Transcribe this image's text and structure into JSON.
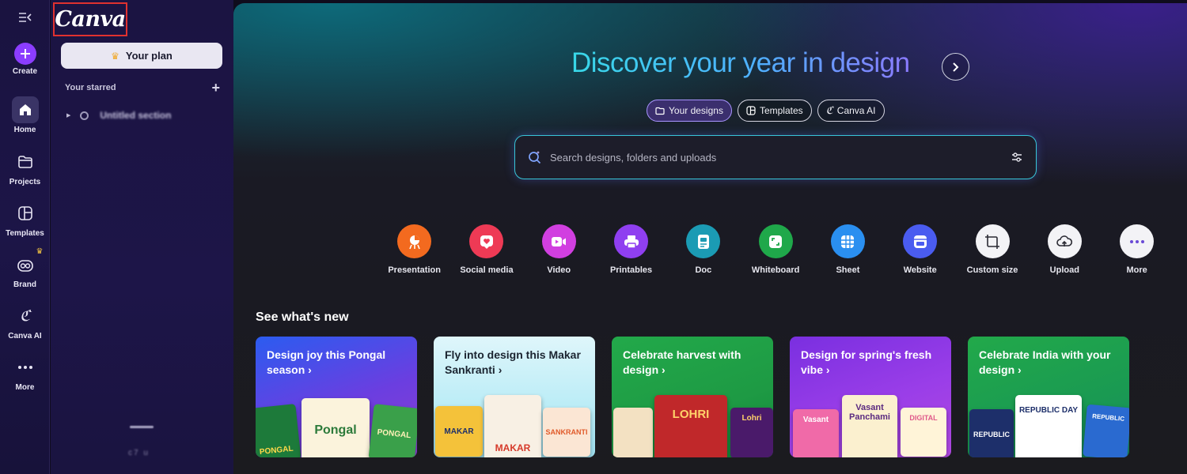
{
  "rail": {
    "items": [
      {
        "label": "Create",
        "icon": "plus-icon"
      },
      {
        "label": "Home",
        "icon": "home-icon",
        "active": true
      },
      {
        "label": "Projects",
        "icon": "folder-icon"
      },
      {
        "label": "Templates",
        "icon": "templates-icon"
      },
      {
        "label": "Brand",
        "icon": "brand-icon"
      },
      {
        "label": "Canva AI",
        "icon": "canva-ai-icon"
      },
      {
        "label": "More",
        "icon": "more-dots-icon"
      }
    ]
  },
  "panel": {
    "logo": "Canva",
    "plan_button": "Your plan",
    "starred_label": "Your starred",
    "section_name": "Untitled section",
    "bottom_text": "c7 u"
  },
  "hero": {
    "title": "Discover your year in design",
    "chips": [
      "Your designs",
      "Templates",
      "Canva AI"
    ],
    "search_placeholder": "Search designs, folders and uploads"
  },
  "tools": [
    {
      "label": "Presentation",
      "color": "#f36a1f"
    },
    {
      "label": "Social media",
      "color": "#ee3a55"
    },
    {
      "label": "Video",
      "color": "#d13fe0"
    },
    {
      "label": "Printables",
      "color": "#8f3ff0"
    },
    {
      "label": "Doc",
      "color": "#1b9bb4"
    },
    {
      "label": "Whiteboard",
      "color": "#1fa84a"
    },
    {
      "label": "Sheet",
      "color": "#2a8ff0"
    },
    {
      "label": "Website",
      "color": "#4a5cf0"
    },
    {
      "label": "Custom size",
      "color": "#f3f3f6"
    },
    {
      "label": "Upload",
      "color": "#f3f3f6"
    },
    {
      "label": "More",
      "color": "#f3f3f6"
    }
  ],
  "whats_new": {
    "title": "See what's new",
    "cards": [
      {
        "title": "Design joy this Pongal season",
        "t1": "PONGAL",
        "t2": "Pongal",
        "t3": "PONGAL"
      },
      {
        "title": "Fly into design this Makar Sankranti",
        "t1": "MAKAR",
        "t2": "MAKAR",
        "t3": "SANKRANTI"
      },
      {
        "title": "Celebrate harvest with design",
        "t1": "",
        "t2": "LOHRI",
        "t3": "Lohri"
      },
      {
        "title": "Design for spring's fresh vibe",
        "t1": "Vasant",
        "t2": "Vasant Panchami",
        "t3": "DIGITAL"
      },
      {
        "title": "Celebrate India with your design",
        "t1": "REPUBLIC",
        "t2": "REPUBLIC DAY",
        "t3": "REPUBLIC"
      }
    ]
  }
}
